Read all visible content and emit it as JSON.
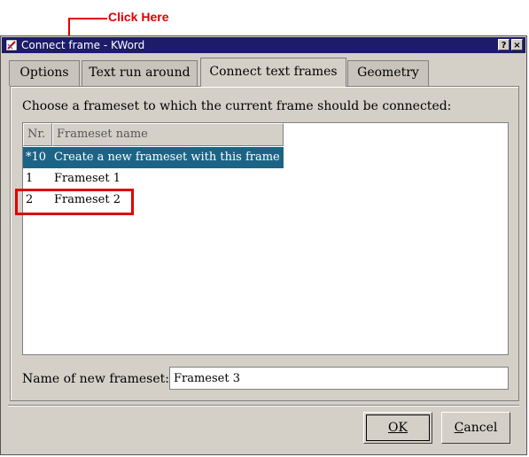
{
  "annotation": {
    "label": "Click Here"
  },
  "window": {
    "title": "Connect frame - KWord",
    "help_btn": "?",
    "close_btn": "×"
  },
  "tabs": [
    {
      "label": "Options"
    },
    {
      "label": "Text run around"
    },
    {
      "label": "Connect text frames"
    },
    {
      "label": "Geometry"
    }
  ],
  "active_tab": "Connect text frames",
  "prompt": "Choose a frameset to which the current frame should be connected:",
  "list": {
    "columns": [
      "Nr.",
      "Frameset name"
    ],
    "rows": [
      {
        "nr": "*10",
        "name": "Create a new frameset with this frame",
        "selected": true
      },
      {
        "nr": "1",
        "name": "Frameset 1",
        "selected": false
      },
      {
        "nr": "2",
        "name": "Frameset 2",
        "selected": false
      }
    ]
  },
  "new_frameset": {
    "label": "Name of new frameset:",
    "value": "Frameset 3"
  },
  "buttons": {
    "ok": "OK",
    "cancel_first": "C",
    "cancel_rest": "ancel"
  },
  "colors": {
    "titlebar": "#1c1c6b",
    "selection": "#1c6485",
    "annotation": "#e00000"
  }
}
